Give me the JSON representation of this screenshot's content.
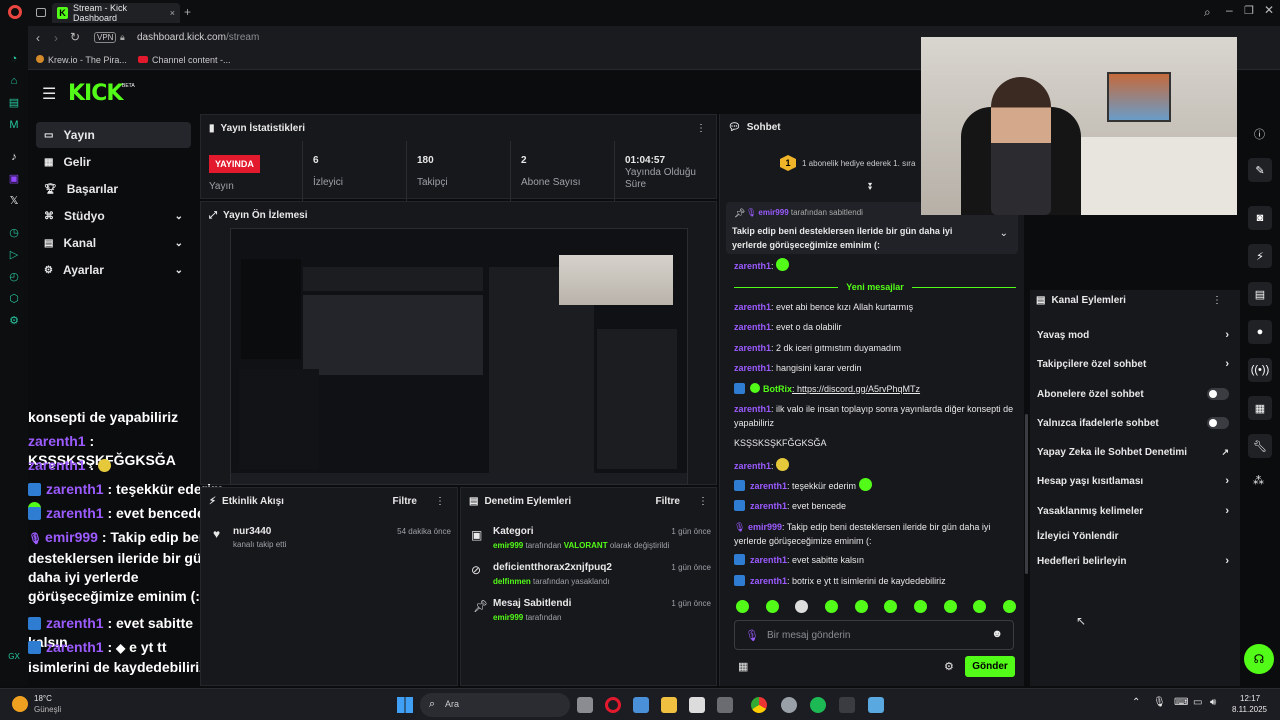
{
  "browser": {
    "tab_title": "Stream - Kick Dashboard",
    "url_host": "dashboard.kick.com",
    "url_path": "/stream",
    "vpn_label": "VPN",
    "bookmarks": [
      "Krew.io - The Pira...",
      "Channel content -..."
    ]
  },
  "brand": {
    "logo": "KICK",
    "beta": "BETA"
  },
  "nav": {
    "items": [
      {
        "label": "Yayın",
        "icon": "video-icon",
        "active": true
      },
      {
        "label": "Gelir",
        "icon": "revenue-icon"
      },
      {
        "label": "Başarılar",
        "icon": "trophy-icon"
      },
      {
        "label": "Stüdyo",
        "icon": "studio-icon"
      },
      {
        "label": "Kanal",
        "icon": "channel-icon"
      },
      {
        "label": "Ayarlar",
        "icon": "gear-icon"
      }
    ]
  },
  "stats": {
    "title": "Yayın İstatistikleri",
    "live_badge": "YAYINDA",
    "cells": [
      {
        "value": "",
        "label": "Yayın"
      },
      {
        "value": "6",
        "label": "İzleyici"
      },
      {
        "value": "180",
        "label": "Takipçi"
      },
      {
        "value": "2",
        "label": "Abone Sayısı"
      },
      {
        "value": "01:04:57",
        "label": "Yayında Olduğu Süre"
      }
    ]
  },
  "preview": {
    "title": "Yayın Ön İzlemesi"
  },
  "activity": {
    "title": "Etkinlik Akışı",
    "filter": "Filtre",
    "items": [
      {
        "user": "nur3440",
        "text": "kanalı takip etti",
        "time": "54 dakika önce"
      }
    ]
  },
  "moderation": {
    "title": "Denetim Eylemleri",
    "filter": "Filtre",
    "items": [
      {
        "title": "Kategori",
        "actor": "emir999",
        "mid": " tarafından ",
        "target": "VALORANT",
        "rest": " olarak değiştirildi",
        "time": "1 gün önce"
      },
      {
        "title": "deficientthorax2xnjfpuq2",
        "actor": "delfinmen",
        "mid": " tarafından yasaklandı",
        "target": "",
        "rest": "",
        "time": "1 gün önce"
      },
      {
        "title": "Mesaj Sabitlendi",
        "actor": "emir999",
        "mid": " tarafından",
        "target": "",
        "rest": "",
        "time": "1 gün önce"
      }
    ]
  },
  "overlay_chat": [
    {
      "user": "",
      "text": "konsepti de yapabiliriz"
    },
    {
      "user": "zarenth1",
      "text": " : KSŞSKSŞKFĞGKSĞA"
    },
    {
      "user": "zarenth1",
      "text": " :"
    },
    {
      "user": "zarenth1",
      "text": " : teşekkür ederim"
    },
    {
      "user": "zarenth1",
      "text": " : evet bencede"
    },
    {
      "user": "emir999",
      "text": " : Takip edip beni desteklersen ileride bir gün daha iyi yerlerde görüşeceğimize eminim (:"
    },
    {
      "user": "zarenth1",
      "text": " : evet sabitte kalsın"
    },
    {
      "user": "zarenth1",
      "text": " :"
    },
    {
      "user": "",
      "text": "e yt tt isimlerini de kaydedebiliriz"
    }
  ],
  "chat": {
    "title": "Sohbet",
    "gift_banner": "1 abonelik hediye ederek 1. sıra",
    "pinned_by": "emir999",
    "pinned_suffix": " tarafından sabitlendi",
    "pinned_text": "Takip edip beni desteklersen ileride bir gün daha iyi yerlerde görüşeceğimize eminim (:",
    "new_messages": "Yeni mesajlar",
    "messages": [
      {
        "user": "zarenth1",
        "text": ":"
      },
      {
        "user": "zarenth1",
        "text": ": evet abi bence kızı Allah kurtarmış"
      },
      {
        "user": "zarenth1",
        "text": ": evet o da olabilir"
      },
      {
        "user": "zarenth1",
        "text": ": 2 dk iceri gıtmıstım duyamadım"
      },
      {
        "user": "zarenth1",
        "text": ": hangisini karar verdin"
      },
      {
        "user": "BotRix",
        "text": ": https://discord.gg/A5rvPhqMTz"
      },
      {
        "user": "zarenth1",
        "text": ": ilk valo ile insan toplayıp sonra yayınlarda diğer konsepti de yapabiliriz"
      },
      {
        "user": "",
        "text": "KSŞSKSŞKFĞGKSĞA"
      },
      {
        "user": "zarenth1",
        "text": ":"
      },
      {
        "user": "zarenth1",
        "text": ": teşekkür ederim"
      },
      {
        "user": "zarenth1",
        "text": ": evet bencede"
      },
      {
        "user": "emir999",
        "text": ": Takip edip beni desteklersen ileride bir gün daha iyi yerlerde görüşeceğimize eminim (:"
      },
      {
        "user": "zarenth1",
        "text": ": evet sabitte kalsın"
      },
      {
        "user": "zarenth1",
        "text": ": botrix e yt tt isimlerini de kaydedebiliriz"
      }
    ],
    "input_placeholder": "Bir mesaj gönderin",
    "send_label": "Gönder"
  },
  "channel_actions": {
    "title": "Kanal Eylemleri",
    "rows": [
      {
        "label": "Yavaş mod",
        "kind": "arrow"
      },
      {
        "label": "Takipçilere özel sohbet",
        "kind": "arrow"
      },
      {
        "label": "Abonelere özel sohbet",
        "kind": "toggle"
      },
      {
        "label": "Yalnızca ifadelerle sohbet",
        "kind": "toggle"
      },
      {
        "label": "Yapay Zeka ile Sohbet Denetimi",
        "kind": "external"
      },
      {
        "label": "Hesap yaşı kısıtlaması",
        "kind": "arrow"
      },
      {
        "label": "Yasaklanmış kelimeler",
        "kind": "arrow"
      },
      {
        "label": "İzleyici Yönlendir",
        "kind": "none"
      },
      {
        "label": "Hedefleri belirleyin",
        "kind": "arrow"
      }
    ]
  },
  "taskbar": {
    "weather_temp": "18°C",
    "weather_desc": "Güneşli",
    "search_placeholder": "Ara",
    "time": "12:17",
    "date": "8.11.2025"
  },
  "colors": {
    "accent": "#53fc18",
    "live": "#e3192d",
    "username": "#9b5bff",
    "panel": "#17181c"
  }
}
